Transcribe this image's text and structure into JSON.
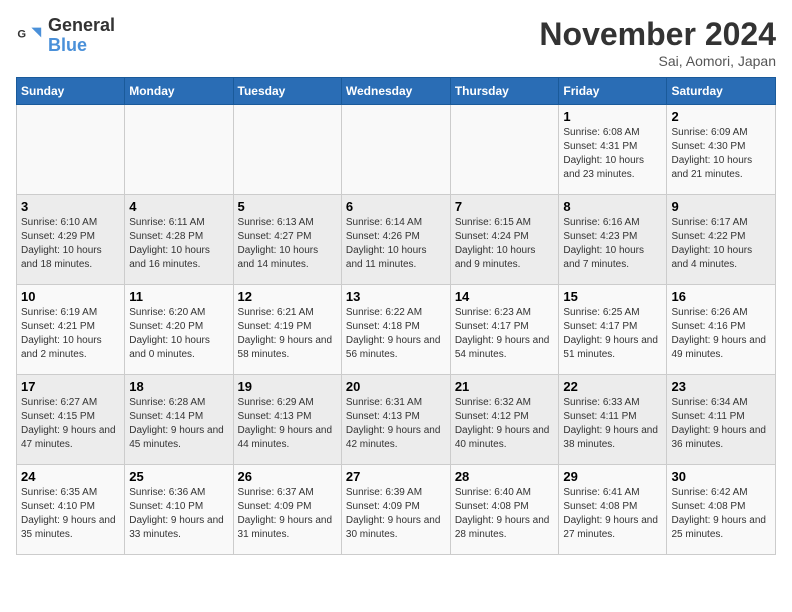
{
  "logo": {
    "line1": "General",
    "line2": "Blue"
  },
  "title": "November 2024",
  "subtitle": "Sai, Aomori, Japan",
  "weekdays": [
    "Sunday",
    "Monday",
    "Tuesday",
    "Wednesday",
    "Thursday",
    "Friday",
    "Saturday"
  ],
  "weeks": [
    [
      {
        "day": "",
        "info": ""
      },
      {
        "day": "",
        "info": ""
      },
      {
        "day": "",
        "info": ""
      },
      {
        "day": "",
        "info": ""
      },
      {
        "day": "",
        "info": ""
      },
      {
        "day": "1",
        "info": "Sunrise: 6:08 AM\nSunset: 4:31 PM\nDaylight: 10 hours and 23 minutes."
      },
      {
        "day": "2",
        "info": "Sunrise: 6:09 AM\nSunset: 4:30 PM\nDaylight: 10 hours and 21 minutes."
      }
    ],
    [
      {
        "day": "3",
        "info": "Sunrise: 6:10 AM\nSunset: 4:29 PM\nDaylight: 10 hours and 18 minutes."
      },
      {
        "day": "4",
        "info": "Sunrise: 6:11 AM\nSunset: 4:28 PM\nDaylight: 10 hours and 16 minutes."
      },
      {
        "day": "5",
        "info": "Sunrise: 6:13 AM\nSunset: 4:27 PM\nDaylight: 10 hours and 14 minutes."
      },
      {
        "day": "6",
        "info": "Sunrise: 6:14 AM\nSunset: 4:26 PM\nDaylight: 10 hours and 11 minutes."
      },
      {
        "day": "7",
        "info": "Sunrise: 6:15 AM\nSunset: 4:24 PM\nDaylight: 10 hours and 9 minutes."
      },
      {
        "day": "8",
        "info": "Sunrise: 6:16 AM\nSunset: 4:23 PM\nDaylight: 10 hours and 7 minutes."
      },
      {
        "day": "9",
        "info": "Sunrise: 6:17 AM\nSunset: 4:22 PM\nDaylight: 10 hours and 4 minutes."
      }
    ],
    [
      {
        "day": "10",
        "info": "Sunrise: 6:19 AM\nSunset: 4:21 PM\nDaylight: 10 hours and 2 minutes."
      },
      {
        "day": "11",
        "info": "Sunrise: 6:20 AM\nSunset: 4:20 PM\nDaylight: 10 hours and 0 minutes."
      },
      {
        "day": "12",
        "info": "Sunrise: 6:21 AM\nSunset: 4:19 PM\nDaylight: 9 hours and 58 minutes."
      },
      {
        "day": "13",
        "info": "Sunrise: 6:22 AM\nSunset: 4:18 PM\nDaylight: 9 hours and 56 minutes."
      },
      {
        "day": "14",
        "info": "Sunrise: 6:23 AM\nSunset: 4:17 PM\nDaylight: 9 hours and 54 minutes."
      },
      {
        "day": "15",
        "info": "Sunrise: 6:25 AM\nSunset: 4:17 PM\nDaylight: 9 hours and 51 minutes."
      },
      {
        "day": "16",
        "info": "Sunrise: 6:26 AM\nSunset: 4:16 PM\nDaylight: 9 hours and 49 minutes."
      }
    ],
    [
      {
        "day": "17",
        "info": "Sunrise: 6:27 AM\nSunset: 4:15 PM\nDaylight: 9 hours and 47 minutes."
      },
      {
        "day": "18",
        "info": "Sunrise: 6:28 AM\nSunset: 4:14 PM\nDaylight: 9 hours and 45 minutes."
      },
      {
        "day": "19",
        "info": "Sunrise: 6:29 AM\nSunset: 4:13 PM\nDaylight: 9 hours and 44 minutes."
      },
      {
        "day": "20",
        "info": "Sunrise: 6:31 AM\nSunset: 4:13 PM\nDaylight: 9 hours and 42 minutes."
      },
      {
        "day": "21",
        "info": "Sunrise: 6:32 AM\nSunset: 4:12 PM\nDaylight: 9 hours and 40 minutes."
      },
      {
        "day": "22",
        "info": "Sunrise: 6:33 AM\nSunset: 4:11 PM\nDaylight: 9 hours and 38 minutes."
      },
      {
        "day": "23",
        "info": "Sunrise: 6:34 AM\nSunset: 4:11 PM\nDaylight: 9 hours and 36 minutes."
      }
    ],
    [
      {
        "day": "24",
        "info": "Sunrise: 6:35 AM\nSunset: 4:10 PM\nDaylight: 9 hours and 35 minutes."
      },
      {
        "day": "25",
        "info": "Sunrise: 6:36 AM\nSunset: 4:10 PM\nDaylight: 9 hours and 33 minutes."
      },
      {
        "day": "26",
        "info": "Sunrise: 6:37 AM\nSunset: 4:09 PM\nDaylight: 9 hours and 31 minutes."
      },
      {
        "day": "27",
        "info": "Sunrise: 6:39 AM\nSunset: 4:09 PM\nDaylight: 9 hours and 30 minutes."
      },
      {
        "day": "28",
        "info": "Sunrise: 6:40 AM\nSunset: 4:08 PM\nDaylight: 9 hours and 28 minutes."
      },
      {
        "day": "29",
        "info": "Sunrise: 6:41 AM\nSunset: 4:08 PM\nDaylight: 9 hours and 27 minutes."
      },
      {
        "day": "30",
        "info": "Sunrise: 6:42 AM\nSunset: 4:08 PM\nDaylight: 9 hours and 25 minutes."
      }
    ]
  ]
}
